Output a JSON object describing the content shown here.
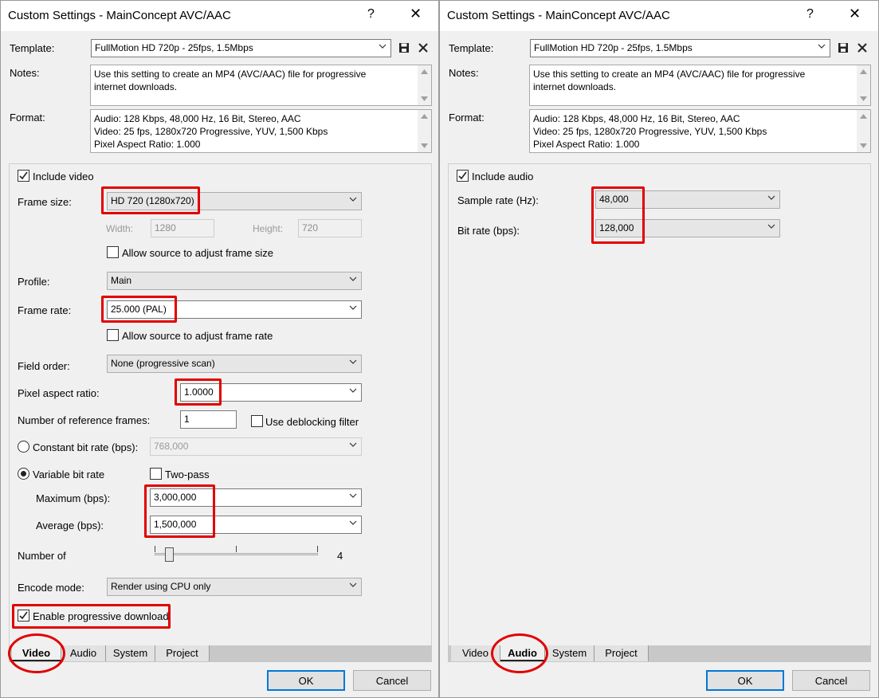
{
  "left": {
    "title": "Custom Settings - MainConcept AVC/AAC",
    "help_glyph": "?",
    "close_glyph": "✕",
    "template_label": "Template:",
    "template_value": "FullMotion HD 720p - 25fps, 1.5Mbps",
    "notes_label": "Notes:",
    "notes_line1": "Use this setting to create an MP4 (AVC/AAC) file for progressive",
    "notes_line2": "internet downloads.",
    "format_label": "Format:",
    "format_line1": "Audio: 128 Kbps, 48,000 Hz, 16 Bit, Stereo, AAC",
    "format_line2": "Video: 25 fps, 1280x720 Progressive, YUV, 1,500 Kbps",
    "format_line3": "Pixel Aspect Ratio: 1.000",
    "include_video_label": "Include video",
    "include_video_checked": true,
    "frame_size_label": "Frame size:",
    "frame_size_value": "HD 720 (1280x720)",
    "width_label": "Width:",
    "width_value": "1280",
    "height_label": "Height:",
    "height_value": "720",
    "allow_frame_size_label": "Allow source to adjust frame size",
    "profile_label": "Profile:",
    "profile_value": "Main",
    "frame_rate_label": "Frame rate:",
    "frame_rate_value": "25.000 (PAL)",
    "allow_frame_rate_label": "Allow source to adjust frame rate",
    "field_order_label": "Field order:",
    "field_order_value": "None (progressive scan)",
    "par_label": "Pixel aspect ratio:",
    "par_value": "1.0000",
    "ref_frames_label": "Number of reference frames:",
    "ref_frames_value": "1",
    "deblocking_label": "Use deblocking filter",
    "cbr_label": "Constant bit rate (bps):",
    "cbr_value": "768,000",
    "vbr_label": "Variable bit rate",
    "two_pass_label": "Two-pass",
    "max_label": "Maximum (bps):",
    "max_value": "3,000,000",
    "avg_label": "Average (bps):",
    "avg_value": "1,500,000",
    "number_of_label": "Number of",
    "slider_value_text": "4",
    "encode_mode_label": "Encode mode:",
    "encode_mode_value": "Render using CPU only",
    "progressive_download_label": "Enable progressive download",
    "tabs": [
      "Video",
      "Audio",
      "System",
      "Project"
    ],
    "active_tab": "Video",
    "ok_label": "OK",
    "cancel_label": "Cancel"
  },
  "right": {
    "title": "Custom Settings - MainConcept AVC/AAC",
    "help_glyph": "?",
    "close_glyph": "✕",
    "template_label": "Template:",
    "template_value": "FullMotion HD 720p - 25fps, 1.5Mbps",
    "notes_label": "Notes:",
    "notes_line1": "Use this setting to create an MP4 (AVC/AAC) file for progressive",
    "notes_line2": "internet downloads.",
    "format_label": "Format:",
    "format_line1": "Audio: 128 Kbps, 48,000 Hz, 16 Bit, Stereo, AAC",
    "format_line2": "Video: 25 fps, 1280x720 Progressive, YUV, 1,500 Kbps",
    "format_line3": "Pixel Aspect Ratio: 1.000",
    "include_audio_label": "Include audio",
    "sample_rate_label": "Sample rate (Hz):",
    "sample_rate_value": "48,000",
    "bit_rate_label": "Bit rate (bps):",
    "bit_rate_value": "128,000",
    "tabs": [
      "Video",
      "Audio",
      "System",
      "Project"
    ],
    "active_tab": "Audio",
    "ok_label": "OK",
    "cancel_label": "Cancel"
  },
  "colors": {
    "highlight": "#e20000",
    "default_button_border": "#0078d7",
    "dialog_bg": "#f0f0f0"
  },
  "icons": [
    "save-icon",
    "delete-icon",
    "help-icon",
    "close-icon",
    "checkmark-icon",
    "dropdown-arrow-icon"
  ]
}
